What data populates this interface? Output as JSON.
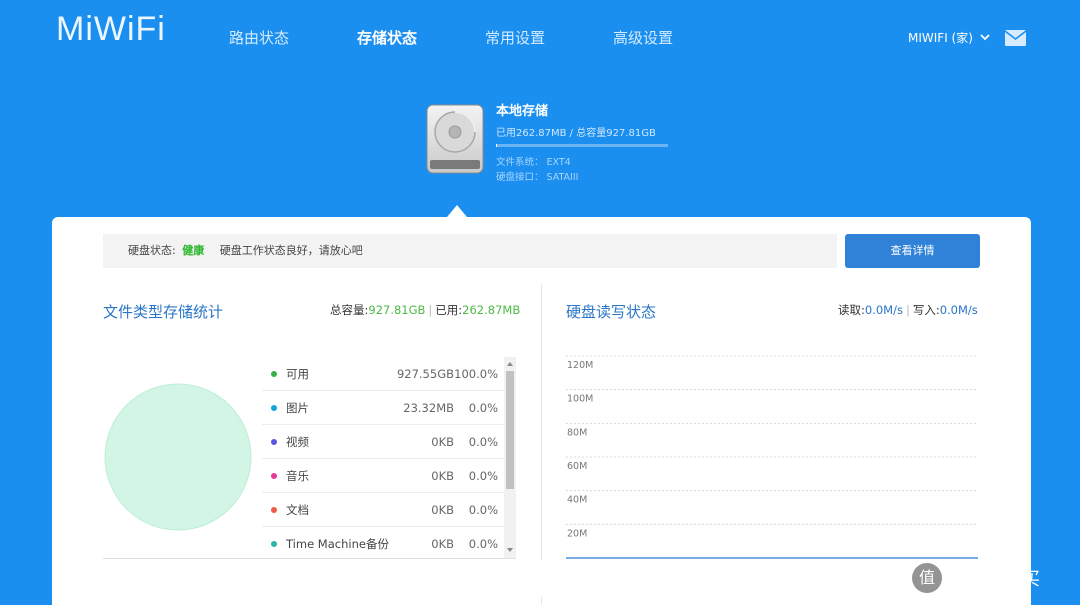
{
  "header": {
    "logo": "MiWiFi",
    "nav": [
      "路由状态",
      "存储状态",
      "常用设置",
      "高级设置"
    ],
    "active_nav": "存储状态",
    "router_name": "MIWIFI (家)",
    "mail_icon": "mail-icon"
  },
  "disk": {
    "title": "本地存储",
    "usage": "已用262.87MB / 总容量927.81GB",
    "used_fraction": 0.0003,
    "filesystem": "文件系统： EXT4",
    "interface": "硬盘接口： SATAIII"
  },
  "status": {
    "label": "硬盘状态:",
    "value": "健康",
    "message": "硬盘工作状态良好，请放心吧",
    "detail_button": "查看详情"
  },
  "storage_stats": {
    "title": "文件类型存储统计",
    "total_label": "总容量:",
    "total_value": "927.81GB",
    "used_label": "已用:",
    "used_value": "262.87MB",
    "items": [
      {
        "name": "可用",
        "size": "927.55GB",
        "pct": "100.0%",
        "color": "#36b24a"
      },
      {
        "name": "图片",
        "size": "23.32MB",
        "pct": "0.0%",
        "color": "#1aa3d9"
      },
      {
        "name": "视频",
        "size": "0KB",
        "pct": "0.0%",
        "color": "#5a55e6"
      },
      {
        "name": "音乐",
        "size": "0KB",
        "pct": "0.0%",
        "color": "#e6399b"
      },
      {
        "name": "文档",
        "size": "0KB",
        "pct": "0.0%",
        "color": "#f05a4a"
      },
      {
        "name": "Time Machine备份",
        "size": "0KB",
        "pct": "0.0%",
        "color": "#29b6a8"
      }
    ],
    "pie_color": "#d3f5e6"
  },
  "rw_status": {
    "title": "硬盘读写状态",
    "read_label": "读取:",
    "read_value": "0.0M/s",
    "write_label": "写入:",
    "write_value": "0.0M/s"
  },
  "chart_data": {
    "type": "line",
    "title": "硬盘读写状态",
    "yticks": [
      "120M",
      "100M",
      "80M",
      "60M",
      "40M",
      "20M"
    ],
    "ylim": [
      0,
      120
    ],
    "grid": true,
    "series": [
      {
        "values": [
          0,
          0,
          0,
          0,
          0,
          0,
          0,
          0,
          0,
          0
        ]
      }
    ]
  },
  "watermark": {
    "logo": "值",
    "text": "什么值得买"
  }
}
